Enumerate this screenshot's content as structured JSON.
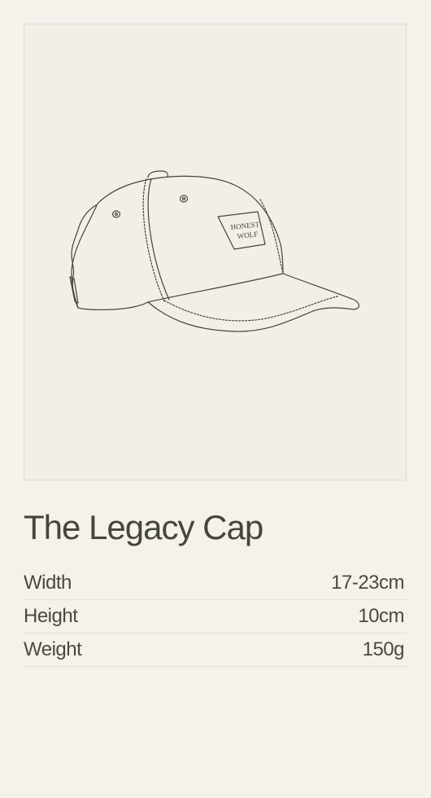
{
  "product": {
    "image_alt": "Line drawing of a baseball cap",
    "patch_line1": "HONEST",
    "patch_line2": "WOLF",
    "title": "The Legacy Cap"
  },
  "specs": [
    {
      "label": "Width",
      "value": "17-23cm"
    },
    {
      "label": "Height",
      "value": "10cm"
    },
    {
      "label": "Weight",
      "value": "150g"
    }
  ],
  "colors": {
    "background": "#f6f2eb",
    "card": "#f3efe7",
    "text": "#4a4a3c",
    "divider": "#e2ddd2"
  }
}
